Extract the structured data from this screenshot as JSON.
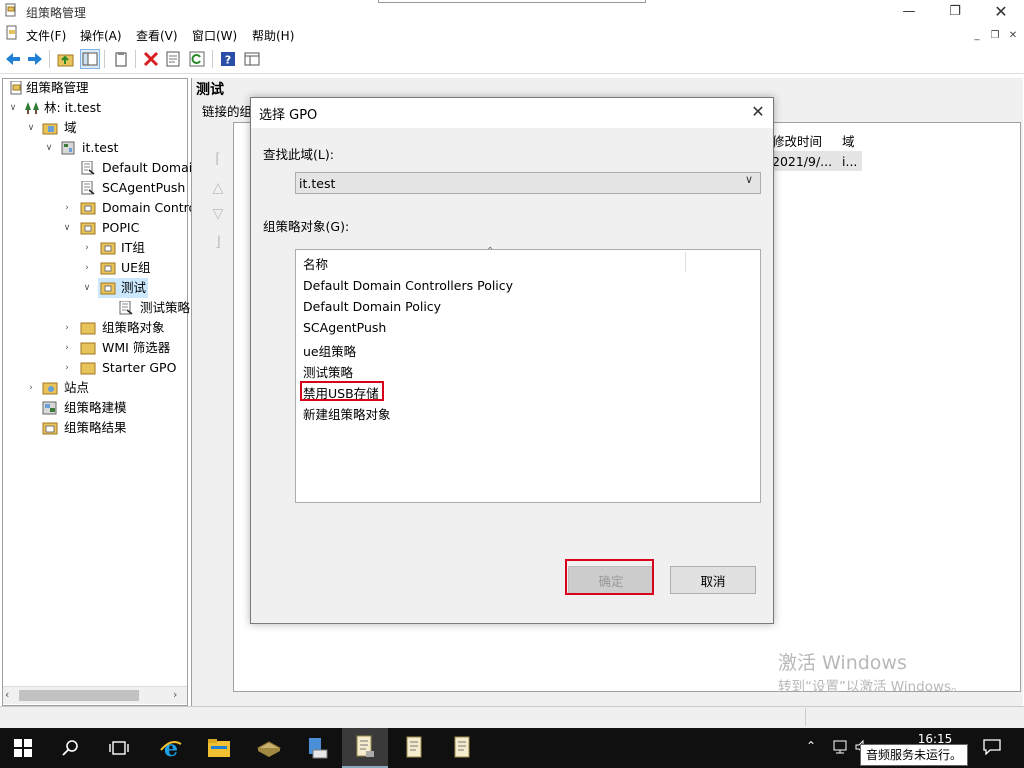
{
  "window": {
    "title": "组策略管理"
  },
  "menu": [
    "文件(F)",
    "操作(A)",
    "查看(V)",
    "窗口(W)",
    "帮助(H)"
  ],
  "tree": {
    "root": "组策略管理",
    "forest": "林: it.test",
    "domains": "域",
    "domain": "it.test",
    "items": [
      "Default Domai",
      "SCAgentPush",
      "Domain Contro",
      "POPIC",
      "IT组",
      "UE组",
      "测试",
      "测试策略",
      "组策略对象",
      "WMI 筛选器",
      "Starter GPO",
      "站点",
      "组策略建模",
      "组策略结果"
    ]
  },
  "right": {
    "title": "测试",
    "linked_label": "链接的组",
    "col_modified": "修改时间",
    "col_domain": "域",
    "row_modified": "2021/9/...",
    "row_domain": "i..."
  },
  "dialog": {
    "title": "选择 GPO",
    "find_label": "查找此域(L):",
    "domain_value": "it.test",
    "gpo_label": "组策略对象(G):",
    "col_name": "名称",
    "items": [
      "Default Domain Controllers Policy",
      "Default Domain Policy",
      "SCAgentPush",
      "ue组策略",
      "测试策略",
      "禁用USB存储",
      "新建组策略对象"
    ],
    "ok": "确定",
    "cancel": "取消"
  },
  "watermark": {
    "line1": "激活 Windows",
    "line2": "转到“设置”以激活 Windows。"
  },
  "taskbar": {
    "time": "16:15",
    "tooltip": "音频服务未运行。"
  },
  "colors": {
    "highlight_red": "#d9001b",
    "selected_bg": "#cce8ff",
    "taskbar": "#101010"
  }
}
